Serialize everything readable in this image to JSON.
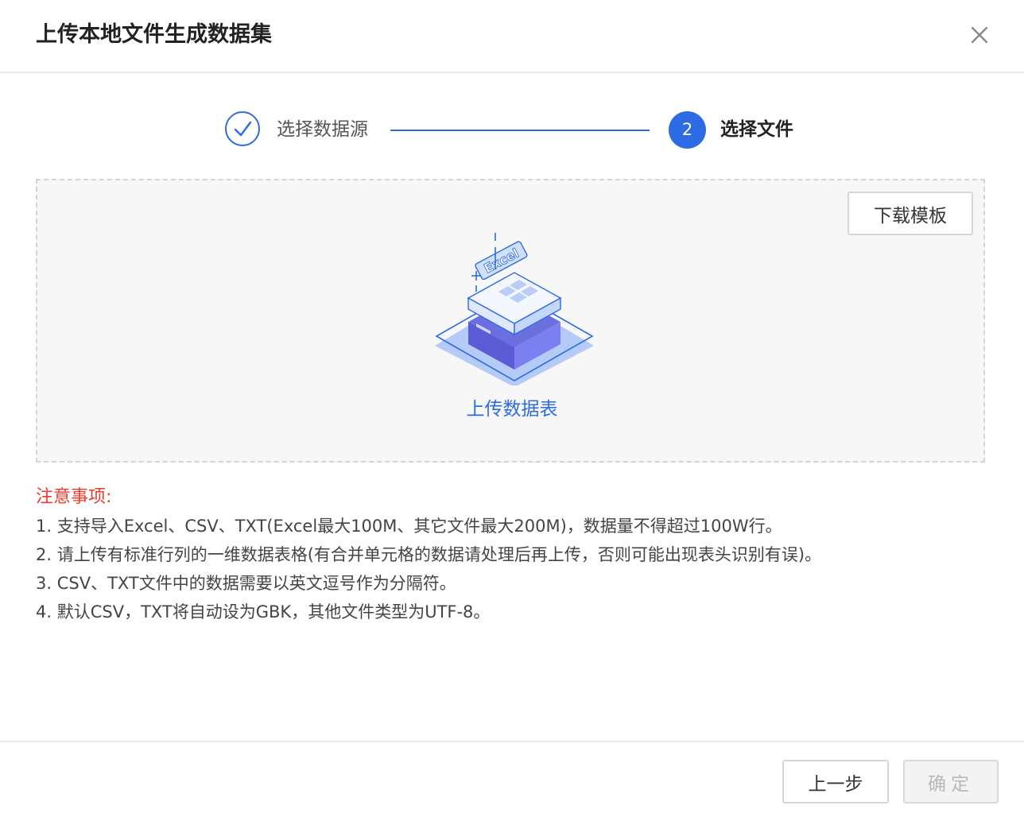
{
  "dialog": {
    "title": "上传本地文件生成数据集"
  },
  "steps": [
    {
      "label": "选择数据源",
      "status": "done"
    },
    {
      "number": "2",
      "label": "选择文件",
      "status": "active"
    }
  ],
  "upload": {
    "download_template_label": "下载模板",
    "illustration_text": "Excel",
    "upload_label": "上传数据表"
  },
  "notes": {
    "title": "注意事项:",
    "items": [
      "1. 支持导入Excel、CSV、TXT(Excel最大100M、其它文件最大200M)，数据量不得超过100W行。",
      "2. 请上传有标准行列的一维数据表格(有合并单元格的数据请处理后再上传，否则可能出现表头识别有误)。",
      "3. CSV、TXT文件中的数据需要以英文逗号作为分隔符。",
      "4. 默认CSV，TXT将自动设为GBK，其他文件类型为UTF-8。"
    ]
  },
  "footer": {
    "prev_label": "上一步",
    "confirm_label": "确定"
  },
  "colors": {
    "primary": "#2d6be4",
    "warning": "#ef3b2d",
    "disabled_text": "#b8b8b8"
  },
  "icons": {
    "close": "close-icon",
    "step_done": "check-icon",
    "illustration": "excel-upload-illustration"
  }
}
